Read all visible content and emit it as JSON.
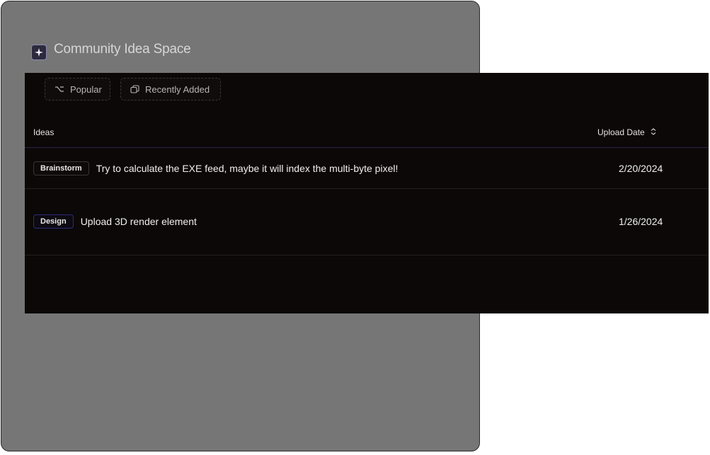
{
  "app": {
    "title": "Community Idea Space",
    "logo_icon": "sparkle-icon"
  },
  "filters": [
    {
      "label": "Popular",
      "icon": "branch-icon"
    },
    {
      "label": "Recently Added",
      "icon": "copy-icon"
    }
  ],
  "table": {
    "columns": {
      "ideas": "Ideas",
      "upload_date": "Upload Date",
      "sort_icon": "sort-updown-icon"
    },
    "rows": [
      {
        "tag": "Brainstorm",
        "idea": "Try to calculate the EXE feed, maybe it will index the multi-byte pixel!",
        "date": "2/20/2024"
      },
      {
        "tag": "Design",
        "idea": "Upload 3D render element",
        "date": "1/26/2024"
      }
    ]
  },
  "colors": {
    "backdrop": "#767676",
    "panel": "#0b0807",
    "design_tag_border": "#2e2c7a"
  }
}
